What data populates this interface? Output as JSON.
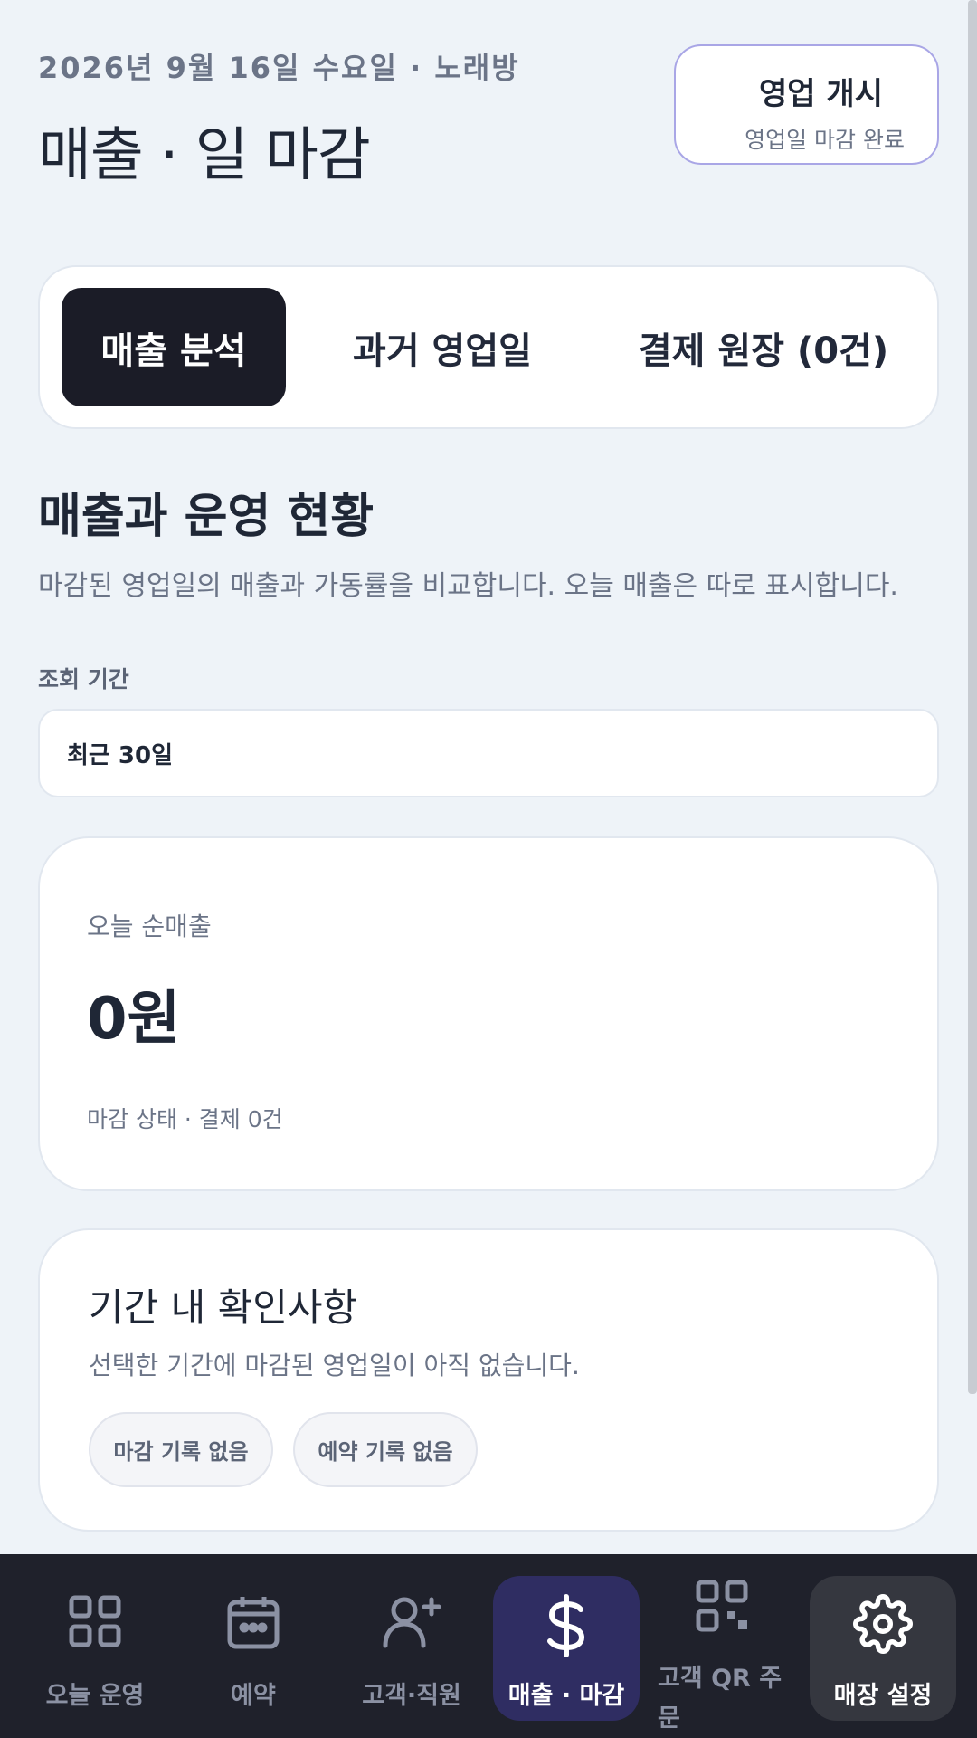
{
  "header": {
    "date_line": "2026년 9월 16일 수요일 · 노래방",
    "title": "매출 · 일 마감",
    "open_button": {
      "title": "영업 개시",
      "subtitle": "영업일 마감 완료"
    }
  },
  "tabs": [
    {
      "label": "매출 분석",
      "active": true
    },
    {
      "label": "과거 영업일",
      "active": false
    },
    {
      "label": "결제 원장 (0건)",
      "active": false
    }
  ],
  "section": {
    "title": "매출과 운영 현황",
    "description": "마감된 영업일의 매출과 가동률을 비교합니다. 오늘 매출은 따로 표시합니다."
  },
  "period": {
    "label": "조회 기간",
    "value": "최근 30일"
  },
  "today": {
    "label": "오늘 순매출",
    "amount": "0원",
    "status": "마감 상태 · 결제 0건"
  },
  "check": {
    "title": "기간 내 확인사항",
    "description": "선택한 기간에 마감된 영업일이 아직 없습니다.",
    "chips": [
      "마감 기록 없음",
      "예약 기록 없음"
    ]
  },
  "bottom_nav": [
    {
      "label": "오늘 운영",
      "icon": "grid-icon"
    },
    {
      "label": "예약",
      "icon": "calendar-icon"
    },
    {
      "label": "고객·직원",
      "icon": "user-plus-icon"
    },
    {
      "label": "매출 · 마감",
      "icon": "dollar-icon",
      "active": true
    },
    {
      "label": "고객 QR 주문",
      "icon": "qr-code-icon"
    },
    {
      "label": "매장 설정",
      "icon": "gear-icon"
    }
  ],
  "colors": {
    "background": "#eef3f8",
    "active_tab": "#1b1c27",
    "nav_background": "#1f212b",
    "nav_active": "#2f2d62",
    "accent_border": "#a9a6e6"
  }
}
